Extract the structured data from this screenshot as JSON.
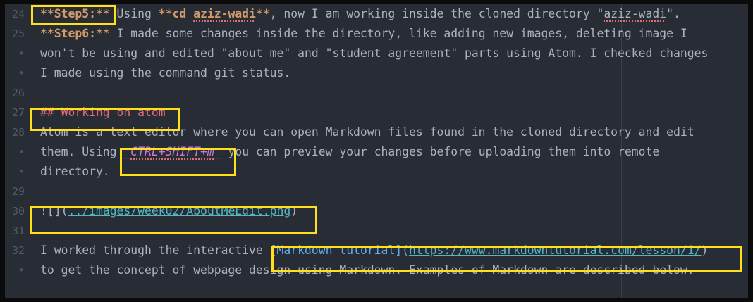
{
  "gutter": {
    "line_numbers": [
      "24",
      "25",
      "•",
      "•",
      "26",
      "27",
      "28",
      "•",
      "•",
      "29",
      "30",
      "31",
      "32",
      "•"
    ]
  },
  "lines": {
    "l24": {
      "step_label": "**Step5:**",
      "t1": " Using ",
      "cmd": "**cd ",
      "cmd_arg": "aziz-wadi",
      "cmd_end": "**",
      "t2": ", now I am working inside the cloned directory \"",
      "dir": "aziz-wadi",
      "t3": "\"."
    },
    "l25": {
      "step_label": "**Step6:**",
      "t1": " I made some changes inside the directory, like adding new images, deleting image I"
    },
    "l25b": {
      "text": "won't be using and edited \"about me\" and \"student agreement\" parts using Atom. I checked changes"
    },
    "l25c": {
      "text": "I made using the command git status."
    },
    "l27": {
      "heading": "## Working on atom"
    },
    "l28": {
      "text": "Atom is a text editor where you can open Markdown files found in the cloned directory and edit"
    },
    "l28b": {
      "t1": "them. Using ",
      "italic_open": "_",
      "shortcut": "CTRL+SHIFT+m",
      "italic_close": "_",
      "t2": " you can preview your changes before uploading them into remote"
    },
    "l28c": {
      "text": "directory."
    },
    "l30": {
      "prefix": "![](",
      "path": "../images/week02/AboutMeEdit.png",
      "suffix": ")"
    },
    "l32": {
      "t1": "I worked through the interactive ",
      "link_open": "[",
      "link_text": "Markdown tutorial",
      "link_mid": "](",
      "url": "https://www.markdowntutorial.com/lesson/1/",
      "link_close": ")"
    },
    "l32b": {
      "text": "to get the concept of webpage design using Markdown. Examples of Markdown are described below."
    }
  },
  "colors": {
    "background": "#282c34",
    "highlight_box": "#ffe01a",
    "bold": "#d19a66",
    "heading": "#e06c75",
    "italic": "#c678dd",
    "link": "#61afef",
    "url": "#56b6c2"
  }
}
